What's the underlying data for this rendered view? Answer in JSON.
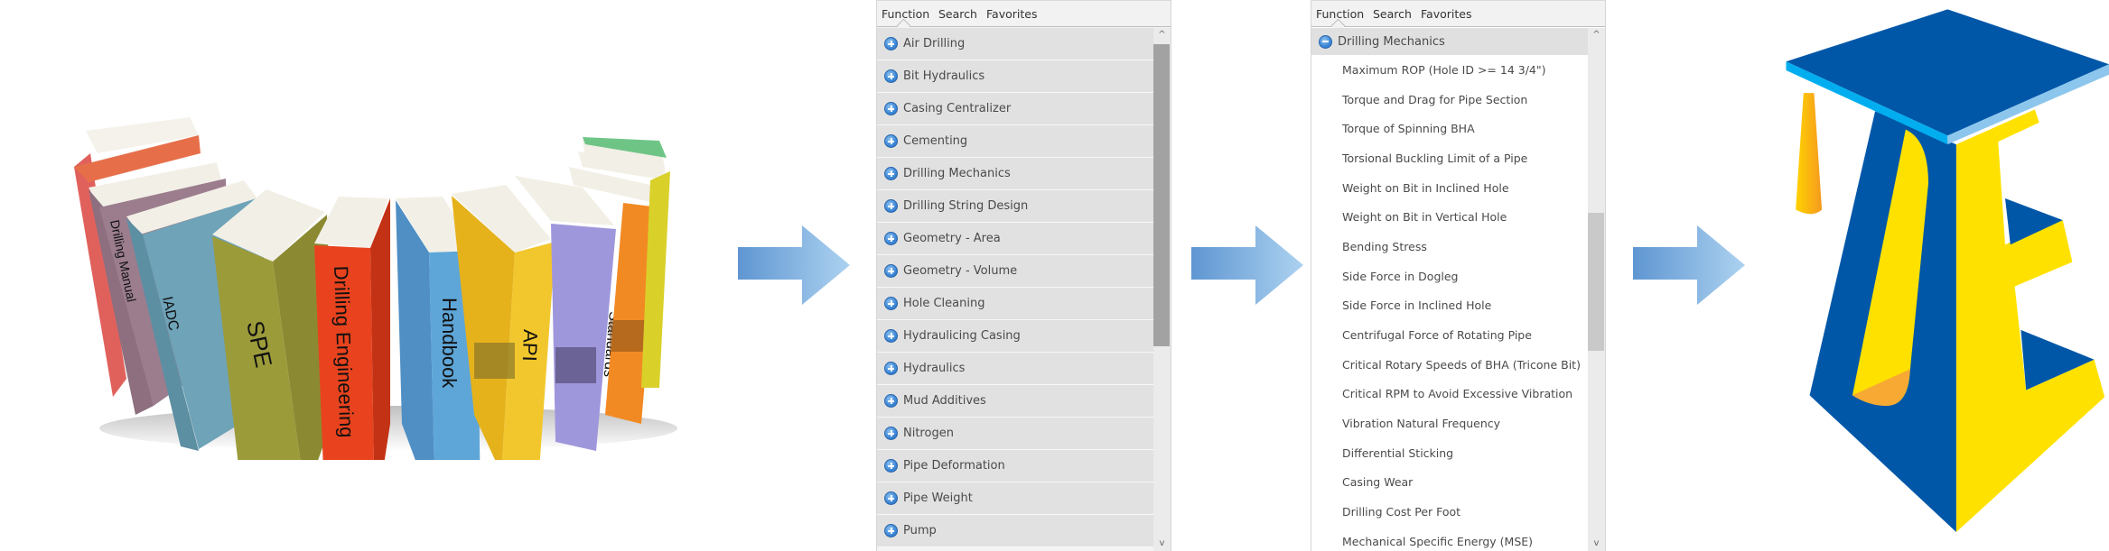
{
  "books": {
    "labels": [
      "Drilling Manual",
      "IADC",
      "SPE",
      "Drilling Engineering",
      "Handbook",
      "API",
      "Standards"
    ]
  },
  "panel_1": {
    "tabs": [
      "Function",
      "Search",
      "Favorites"
    ],
    "active_tab": "Function",
    "categories": [
      {
        "label": "Air Drilling",
        "icon": "plus-circle-icon"
      },
      {
        "label": "Bit Hydraulics",
        "icon": "plus-circle-icon"
      },
      {
        "label": "Casing Centralizer",
        "icon": "plus-circle-icon"
      },
      {
        "label": "Cementing",
        "icon": "plus-circle-icon"
      },
      {
        "label": "Drilling Mechanics",
        "icon": "plus-circle-icon"
      },
      {
        "label": "Drilling String Design",
        "icon": "plus-circle-icon"
      },
      {
        "label": "Geometry - Area",
        "icon": "plus-circle-icon"
      },
      {
        "label": "Geometry - Volume",
        "icon": "plus-circle-icon"
      },
      {
        "label": "Hole Cleaning",
        "icon": "plus-circle-icon"
      },
      {
        "label": "Hydraulicing Casing",
        "icon": "plus-circle-icon"
      },
      {
        "label": "Hydraulics",
        "icon": "plus-circle-icon"
      },
      {
        "label": "Mud Additives",
        "icon": "plus-circle-icon"
      },
      {
        "label": "Nitrogen",
        "icon": "plus-circle-icon"
      },
      {
        "label": "Pipe Deformation",
        "icon": "plus-circle-icon"
      },
      {
        "label": "Pipe Weight",
        "icon": "plus-circle-icon"
      },
      {
        "label": "Pump",
        "icon": "plus-circle-icon"
      }
    ],
    "scroll_up_glyph": "^",
    "scroll_down_glyph": "v"
  },
  "panel_2": {
    "tabs": [
      "Function",
      "Search",
      "Favorites"
    ],
    "active_tab": "Function",
    "expanded_category": {
      "label": "Drilling Mechanics",
      "icon": "minus-circle-icon"
    },
    "items": [
      "Maximum ROP (Hole ID >= 14 3/4\")",
      "Torque and Drag for Pipe Section",
      "Torque of Spinning BHA",
      "Torsional Buckling Limit of a Pipe",
      "Weight on Bit in Inclined Hole",
      "Weight on Bit in Vertical Hole",
      "Bending Stress",
      "Side Force in Dogleg",
      "Side Force in Inclined Hole",
      "Centrifugal Force of Rotating Pipe",
      "Critical Rotary Speeds of BHA (Tricone Bit)",
      "Critical RPM to Avoid Excessive Vibration",
      "Vibration Natural Frequency",
      "Differential Sticking",
      "Casing Wear",
      "Drilling Cost Per Foot",
      "Mechanical Specific Energy (MSE)"
    ],
    "scroll_up_glyph": "^",
    "scroll_down_glyph": "v"
  },
  "colors": {
    "arrow_start": "#5f96d2",
    "arrow_end": "#acd2f0",
    "logo_blue": "#0057a8",
    "logo_yellow": "#ffe100",
    "logo_light_blue": "#00aeef",
    "logo_orange": "#f7a934"
  }
}
